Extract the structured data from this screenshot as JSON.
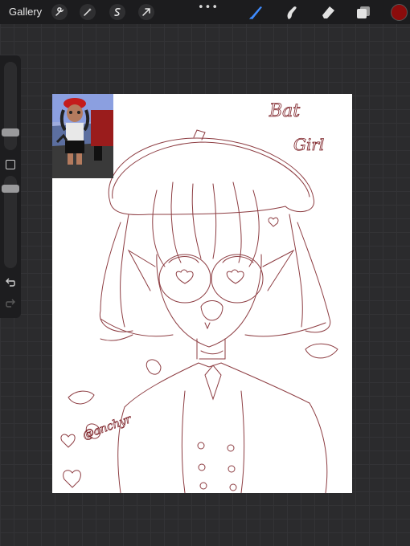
{
  "app": {
    "gallery_label": "Gallery",
    "more_dots": "•••"
  },
  "toolbar": {
    "left_icons": [
      "wrench-icon",
      "magic-wand-icon",
      "selection-icon",
      "transform-arrow-icon"
    ],
    "right_icons": [
      "brush-icon",
      "smudge-icon",
      "eraser-icon",
      "layers-icon"
    ],
    "active_tool": "brush",
    "active_tool_color": "#3f8cff",
    "current_color": "#8b0c0c"
  },
  "sidebar": {
    "icons": [
      "brush-size-slider",
      "modify-button",
      "opacity-slider",
      "undo-icon",
      "redo-icon"
    ]
  },
  "canvas": {
    "background": "#ffffff",
    "sketch_color": "#7a1c22",
    "text_title_line1": "Bat",
    "text_title_line2": "Girl",
    "signature": "@anchyr"
  },
  "reference_image": {
    "description_icon": "reference-photo"
  }
}
